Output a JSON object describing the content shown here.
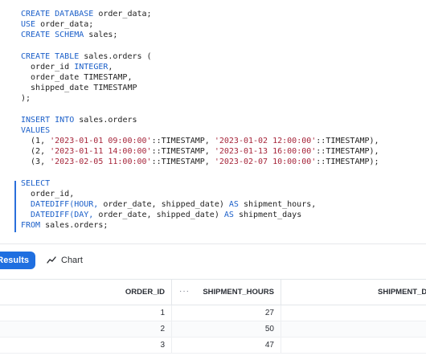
{
  "editor": {
    "lines": {
      "l1": {
        "kw": "CREATE DATABASE",
        "rest": " order_data;"
      },
      "l2": {
        "kw": "USE",
        "rest": " order_data;"
      },
      "l3": {
        "kw": "CREATE SCHEMA",
        "rest": " sales;"
      },
      "l5": {
        "kw": "CREATE TABLE",
        "rest": " sales.orders ("
      },
      "l6": {
        "text": "  order_id ",
        "kw": "INTEGER",
        "rest": ","
      },
      "l7": {
        "text": "  order_date TIMESTAMP,"
      },
      "l8": {
        "text": "  shipped_date TIMESTAMP"
      },
      "l9": {
        "text": ");"
      },
      "l11": {
        "kw1": "INSERT INTO",
        "rest": " sales.orders"
      },
      "l12": {
        "kw": "VALUES"
      },
      "l13": {
        "p1": "  (1, ",
        "s1": "'2023-01-01 09:00:00'",
        "p2": "::TIMESTAMP, ",
        "s2": "'2023-01-02 12:00:00'",
        "p3": "::TIMESTAMP),"
      },
      "l14": {
        "p1": "  (2, ",
        "s1": "'2023-01-11 14:00:00'",
        "p2": "::TIMESTAMP, ",
        "s2": "'2023-01-13 16:00:00'",
        "p3": "::TIMESTAMP),"
      },
      "l15": {
        "p1": "  (3, ",
        "s1": "'2023-02-05 11:00:00'",
        "p2": "::TIMESTAMP, ",
        "s2": "'2023-02-07 10:00:00'",
        "p3": "::TIMESTAMP);"
      },
      "l17": {
        "kw": "SELECT"
      },
      "l18": {
        "text": "  order_id,"
      },
      "l19": {
        "kw": "  DATEDIFF(HOUR,",
        "rest": " order_date, shipped_date) ",
        "kw2": "AS",
        "rest2": " shipment_hours,"
      },
      "l20": {
        "kw": "  DATEDIFF(DAY,",
        "rest": " order_date, shipped_date) ",
        "kw2": "AS",
        "rest2": " shipment_days"
      },
      "l21": {
        "kw": "FROM",
        "rest": " sales.orders;"
      }
    }
  },
  "toolbar": {
    "results_label": "Results",
    "chart_label": "Chart"
  },
  "grid": {
    "headers": {
      "order_id": "ORDER_ID",
      "dots": "···",
      "hours": "SHIPMENT_HOURS",
      "days": "SHIPMENT_D"
    },
    "rows": [
      {
        "order_id": "1",
        "hours": "27"
      },
      {
        "order_id": "2",
        "hours": "50"
      },
      {
        "order_id": "3",
        "hours": "47"
      }
    ]
  },
  "colors": {
    "accent": "#1f6fe0",
    "keyword": "#1b5fc9",
    "string": "#a6253a"
  },
  "icons": {
    "chart_tab": "line-chart-icon"
  }
}
